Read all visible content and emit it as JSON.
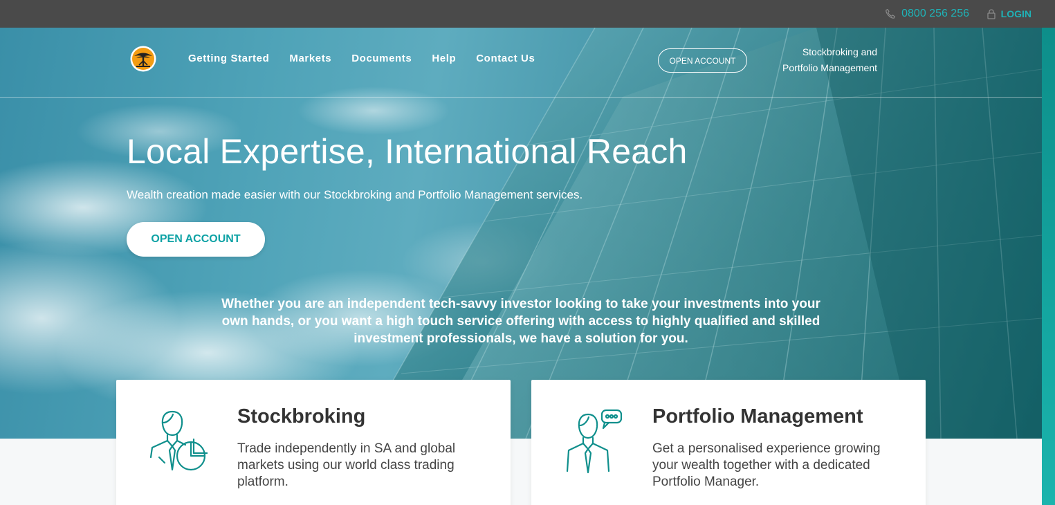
{
  "topbar": {
    "phone": "0800 256 256",
    "login_label": "LOGIN"
  },
  "nav": {
    "links": [
      "Getting Started",
      "Markets",
      "Documents",
      "Help",
      "Contact Us"
    ],
    "open_account_label": "OPEN ACCOUNT",
    "tagline_line1": "Stockbroking and",
    "tagline_line2": "Portfolio Management"
  },
  "hero": {
    "title": "Local Expertise, International Reach",
    "subtitle": "Wealth creation made easier with our Stockbroking and Portfolio Management services.",
    "cta_label": "OPEN ACCOUNT",
    "blurb": "Whether you are an independent tech-savvy investor looking to take your investments into your own hands, or you want a high touch service offering with access to highly qualified and skilled investment professionals, we have a solution for you."
  },
  "cards": [
    {
      "title": "Stockbroking",
      "text": "Trade independently in SA and global markets using our world class trading platform.",
      "icon": "investor-pie-chart-icon"
    },
    {
      "title": "Portfolio Management",
      "text": "Get a personalised experience growing your wealth together with a dedicated Portfolio Manager.",
      "icon": "advisor-chat-icon"
    }
  ],
  "colors": {
    "accent": "#1fb3b7",
    "topbar": "#4a4a4a",
    "icon_teal": "#0f8f8c"
  }
}
